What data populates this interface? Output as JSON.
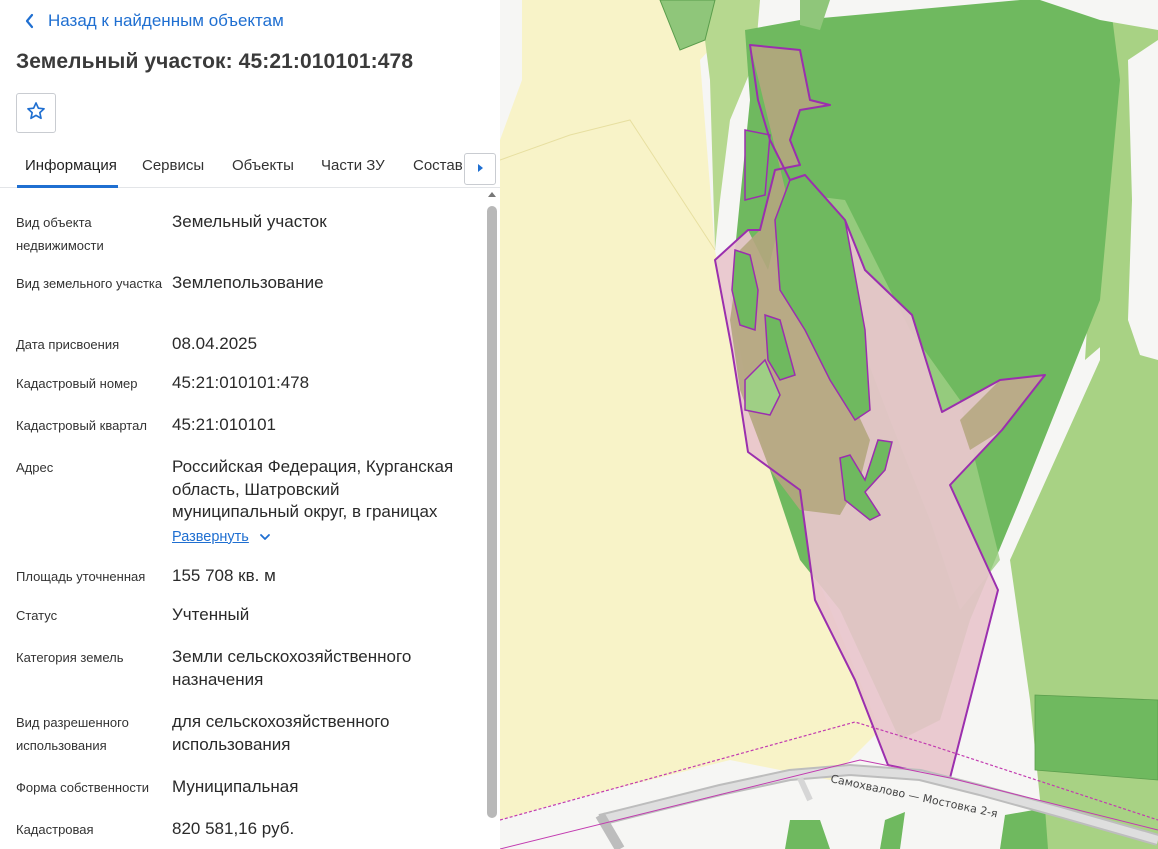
{
  "header": {
    "back_label": "Назад к найденным объектам",
    "title": "Земельный участок: 45:21:010101:478"
  },
  "tabs": [
    {
      "label": "Информация",
      "active": true
    },
    {
      "label": "Сервисы"
    },
    {
      "label": "Объекты"
    },
    {
      "label": "Части ЗУ"
    },
    {
      "label": "Состав"
    }
  ],
  "info": {
    "object_type": {
      "label": "Вид объекта недвижимости",
      "value": "Земельный участок"
    },
    "land_type": {
      "label": "Вид земельного участка",
      "value": "Землепользование"
    },
    "assign_date": {
      "label": "Дата присвоения",
      "value": "08.04.2025"
    },
    "cad_number": {
      "label": "Кадастровый номер",
      "value": "45:21:010101:478"
    },
    "cad_quarter": {
      "label": "Кадастровый квартал",
      "value": "45:21:010101"
    },
    "address": {
      "label": "Адрес",
      "value": "Российская Федерация, Курганская область, Шатровский муниципальный округ, в границах",
      "expand_label": "Развернуть"
    },
    "area": {
      "label": "Площадь уточненная",
      "value": "155 708 кв. м"
    },
    "status": {
      "label": "Статус",
      "value": "Учтенный"
    },
    "land_category": {
      "label": "Категория земель",
      "value": "Земли сельскохозяйственного назначения"
    },
    "permitted_use": {
      "label": "Вид разрешенного использования",
      "value": "для сельскохозяйственного использования"
    },
    "ownership": {
      "label": "Форма собственности",
      "value": "Муниципальная"
    },
    "cad_value": {
      "label": "Кадастровая",
      "value": "820 581,16 руб."
    }
  },
  "map": {
    "road_label": "Самохвалово — Мостовка 2-я",
    "colors": {
      "plot_fill": "#e8c6cc",
      "plot_border": "#9b2fae",
      "forest": "#6fb95f",
      "light_green": "#9fcf85",
      "field": "#f8f3c8",
      "road": "#c9c9c9"
    }
  },
  "icons": {
    "back": "chevron-left-icon",
    "favorite": "star-outline-icon",
    "tabs_next": "caret-right-icon",
    "expand": "chevron-down-icon"
  }
}
